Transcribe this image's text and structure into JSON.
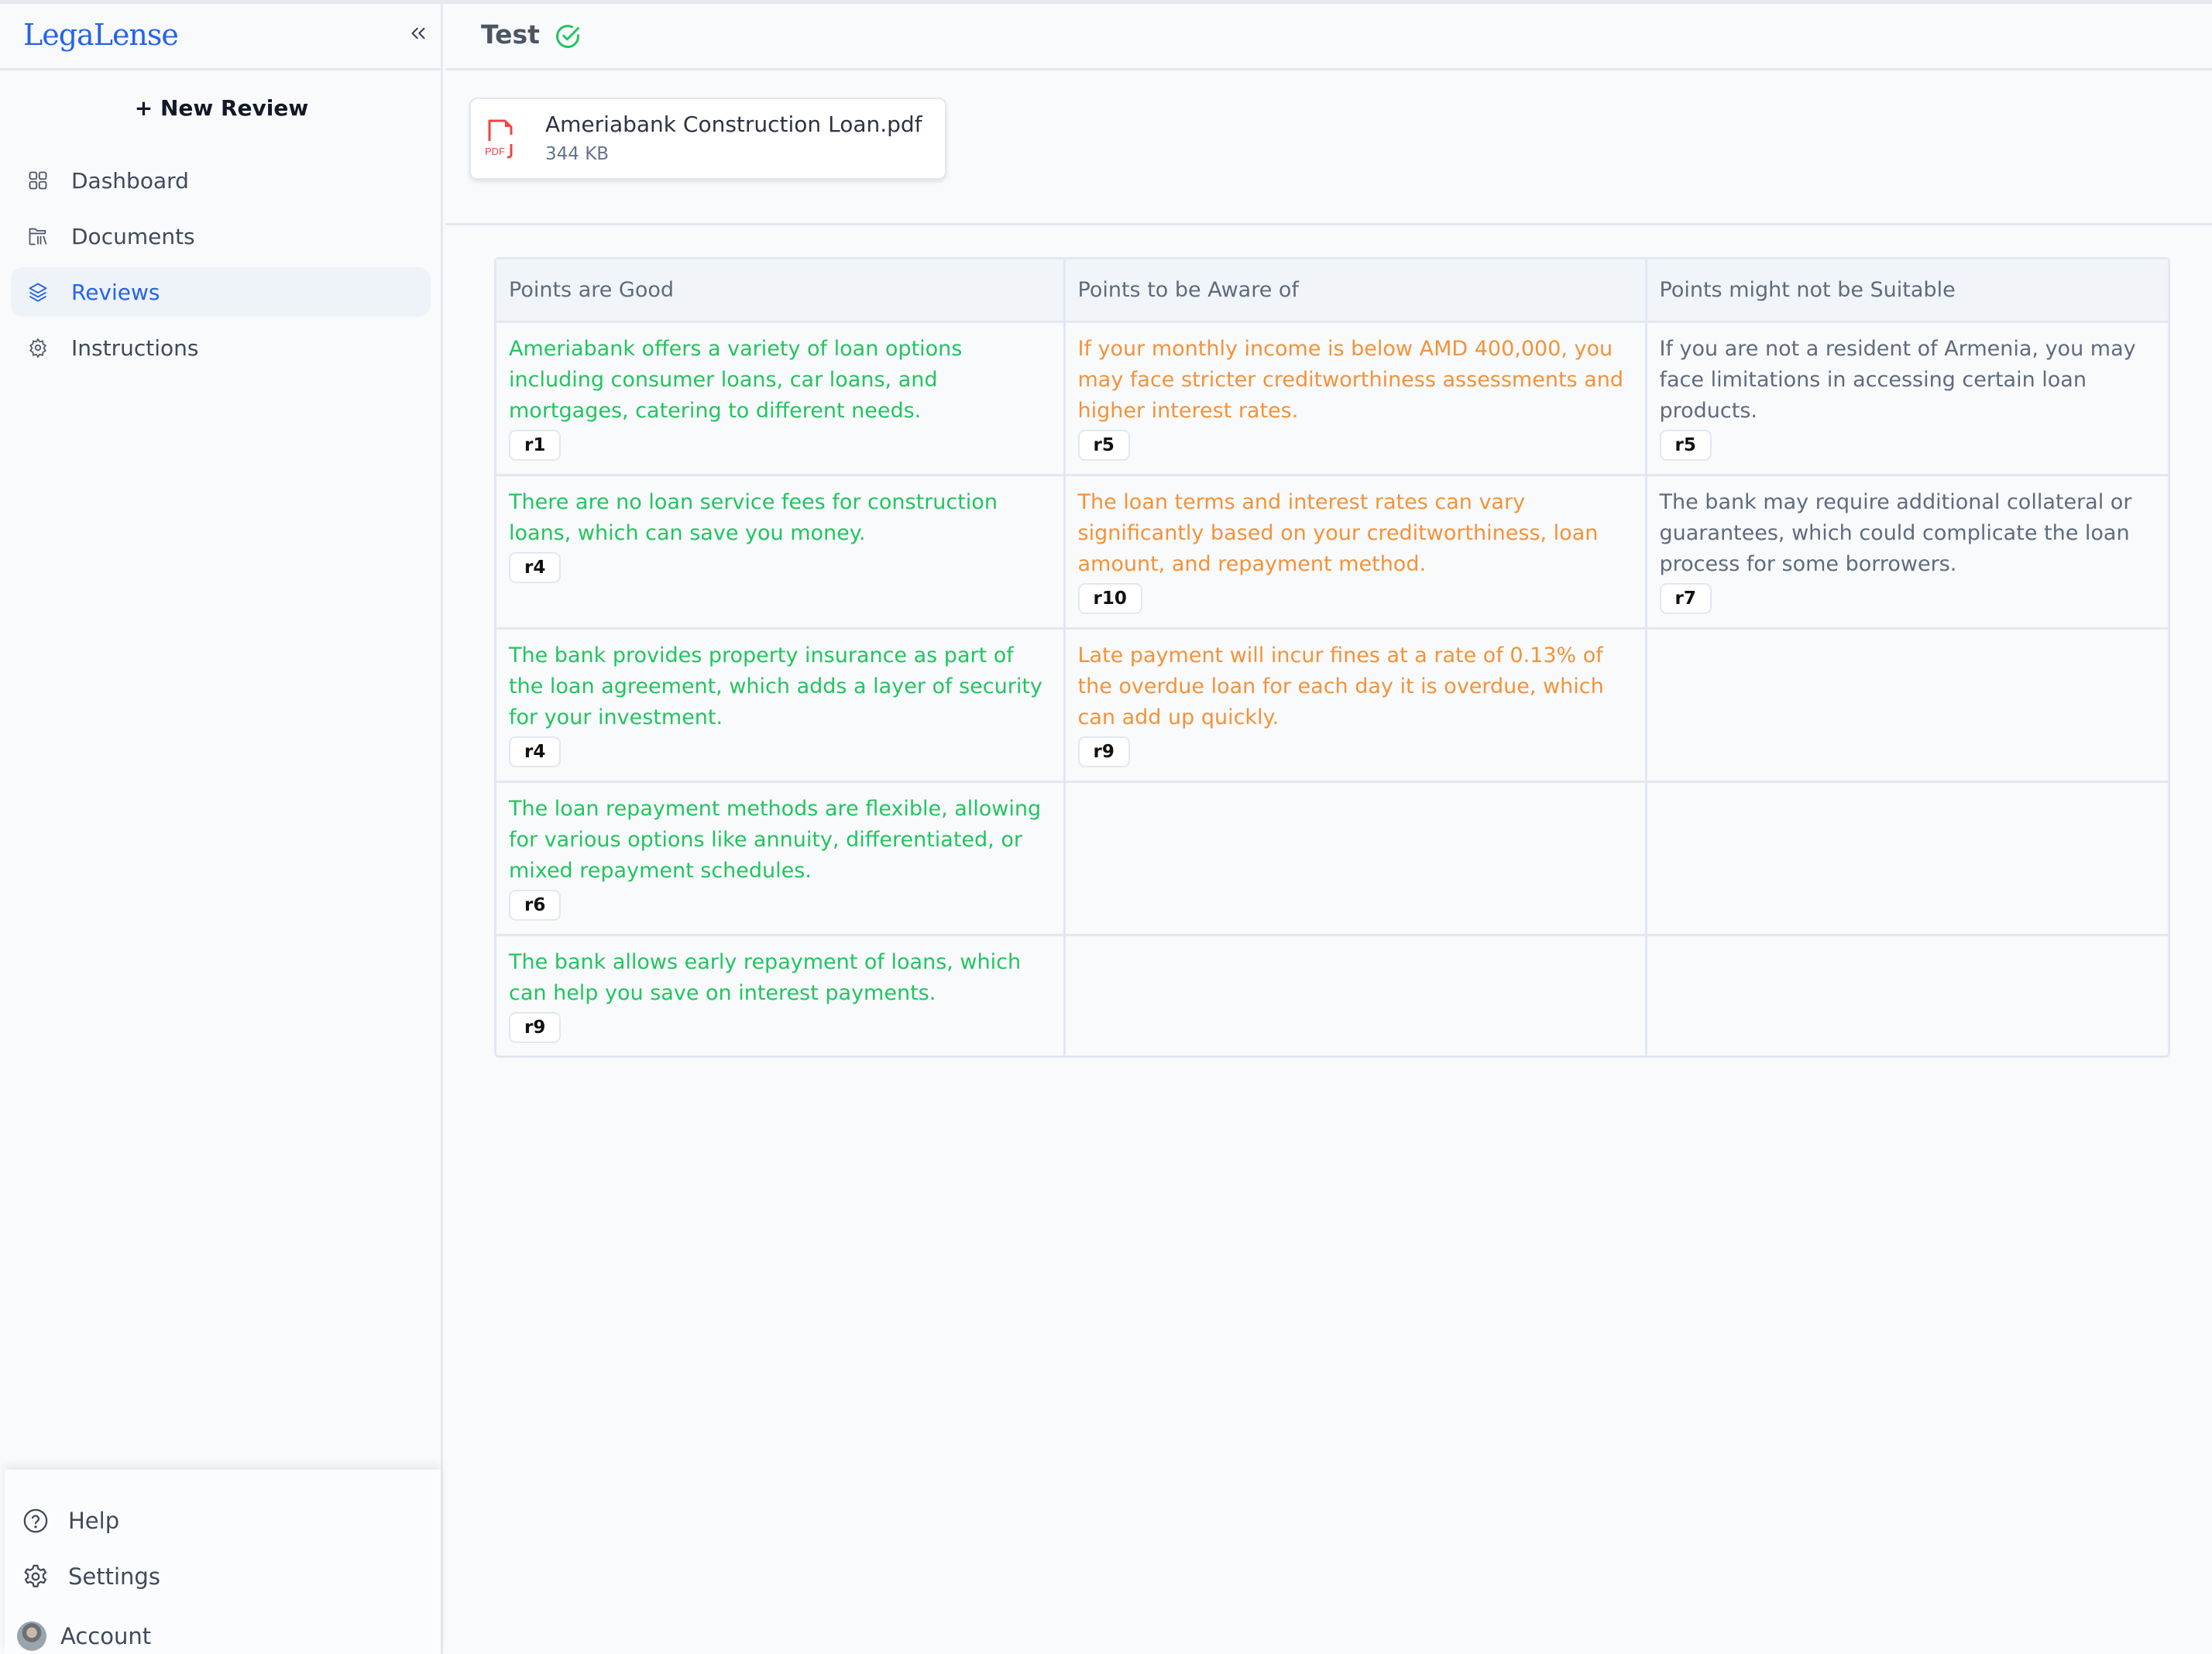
{
  "app": {
    "brand": "LegaLense"
  },
  "sidebar": {
    "collapse_label": "«",
    "new_review_label": "+ New Review",
    "items": [
      {
        "label": "Dashboard",
        "icon": "grid-icon",
        "active": false
      },
      {
        "label": "Documents",
        "icon": "folder-library-icon",
        "active": false
      },
      {
        "label": "Reviews",
        "icon": "layers-icon",
        "active": true
      },
      {
        "label": "Instructions",
        "icon": "gear-icon",
        "active": false
      }
    ],
    "bottom_items": [
      {
        "label": "Help",
        "icon": "help-circle-icon"
      },
      {
        "label": "Settings",
        "icon": "settings-gear-icon"
      },
      {
        "label": "Account",
        "icon": "avatar"
      }
    ]
  },
  "header": {
    "title": "Test",
    "status_icon": "check-circle-icon",
    "status_color": "#22c55e"
  },
  "file": {
    "name": "Ameriabank Construction Loan.pdf",
    "size": "344 KB",
    "icon": "pdf-file-icon",
    "icon_label": "PDF",
    "icon_color": "#ef4444"
  },
  "colors": {
    "good": "#22c55e",
    "aware": "#f59238",
    "unsuitable": "#5f6b7d",
    "accent": "#2563eb"
  },
  "table": {
    "headers": [
      "Points are Good",
      "Points to be Aware of",
      "Points might not be Suitable"
    ],
    "rows": [
      {
        "good": {
          "text": "Ameriabank offers a variety of loan options including consumer loans, car loans, and mortgages, catering to different needs.",
          "ref": "r1"
        },
        "aware": {
          "text": "If your monthly income is below AMD 400,000, you may face stricter creditworthiness assessments and higher interest rates.",
          "ref": "r5"
        },
        "unsuitable": {
          "text": "If you are not a resident of Armenia, you may face limitations in accessing certain loan products.",
          "ref": "r5"
        }
      },
      {
        "good": {
          "text": "There are no loan service fees for construction loans, which can save you money.",
          "ref": "r4"
        },
        "aware": {
          "text": "The loan terms and interest rates can vary significantly based on your creditworthiness, loan amount, and repayment method.",
          "ref": "r10"
        },
        "unsuitable": {
          "text": "The bank may require additional collateral or guarantees, which could complicate the loan process for some borrowers.",
          "ref": "r7"
        }
      },
      {
        "good": {
          "text": "The bank provides property insurance as part of the loan agreement, which adds a layer of security for your investment.",
          "ref": "r4"
        },
        "aware": {
          "text": "Late payment will incur fines at a rate of 0.13% of the overdue loan for each day it is overdue, which can add up quickly.",
          "ref": "r9"
        },
        "unsuitable": null
      },
      {
        "good": {
          "text": "The loan repayment methods are flexible, allowing for various options like annuity, differentiated, or mixed repayment schedules.",
          "ref": "r6"
        },
        "aware": null,
        "unsuitable": null
      },
      {
        "good": {
          "text": "The bank allows early repayment of loans, which can help you save on interest payments.",
          "ref": "r9"
        },
        "aware": null,
        "unsuitable": null
      }
    ]
  }
}
